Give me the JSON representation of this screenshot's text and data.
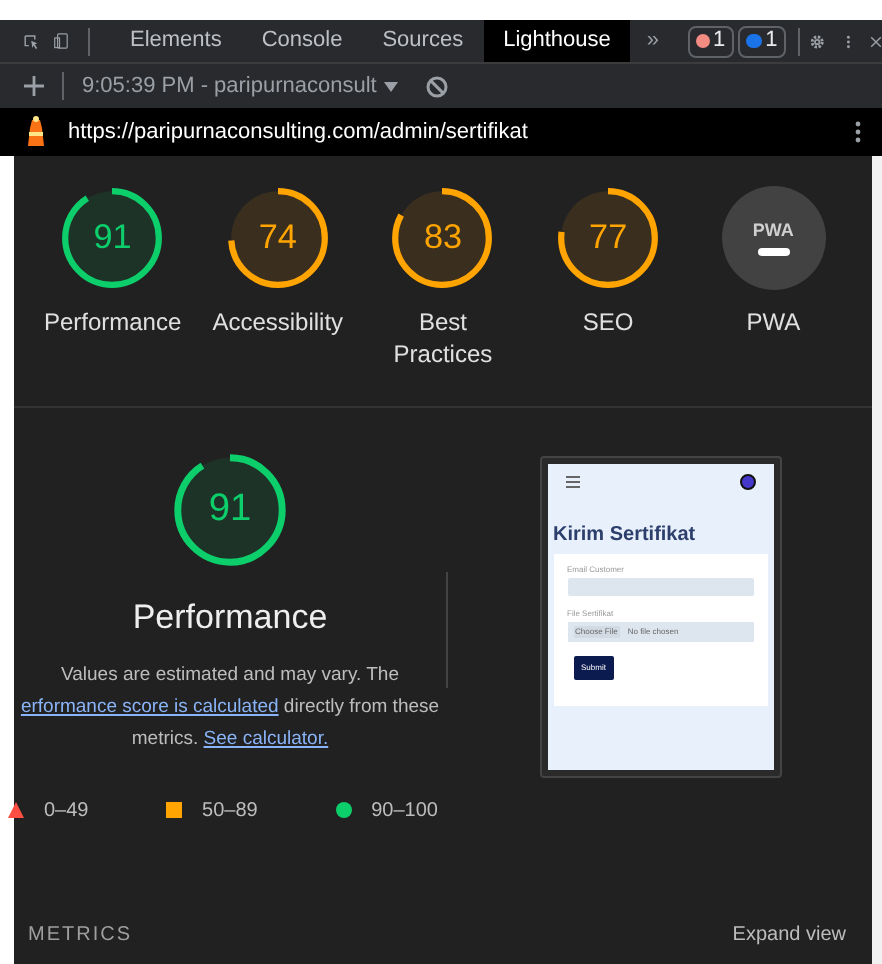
{
  "devtools_tabs": [
    {
      "label": "Elements",
      "selected": false
    },
    {
      "label": "Console",
      "selected": false
    },
    {
      "label": "Sources",
      "selected": false
    },
    {
      "label": "Lighthouse",
      "selected": true
    }
  ],
  "more_tabs": "»",
  "error_count": "1",
  "message_count": "1",
  "report_selector": "9:05:39 PM - paripurnaconsult",
  "url": "https://paripurnaconsulting.com/admin/sertifikat",
  "categories": [
    {
      "kind": "pass",
      "score": "91",
      "label": "Performance"
    },
    {
      "kind": "average",
      "score": "74",
      "label": "Accessibility"
    },
    {
      "kind": "average",
      "score": "83",
      "label": "Best Practices"
    },
    {
      "kind": "average",
      "score": "77",
      "label": "SEO"
    },
    {
      "kind": "pwa",
      "badge": "PWA",
      "label": "PWA"
    }
  ],
  "performance": {
    "kind": "pass",
    "score": "91",
    "title": "Performance",
    "note": {
      "text_1": "Values are estimated and may vary. The",
      "link_1": "erformance score is calculated",
      "text_2": " directly from these",
      "text_3": "metrics. ",
      "link_2": "See calculator."
    },
    "legend": [
      {
        "kind": "fail",
        "range": "0–49"
      },
      {
        "kind": "average",
        "range": "50–89"
      },
      {
        "kind": "pass",
        "range": "90–100"
      }
    ]
  },
  "thumbnail": {
    "heading": "Kirim Sertifikat",
    "email_label": "Email Customer",
    "file_label": "File Sertifikat",
    "file_button": "Choose File",
    "file_status": "No file chosen",
    "submit": "Submit"
  },
  "metrics_heading": "METRICS",
  "expand": "Expand view"
}
